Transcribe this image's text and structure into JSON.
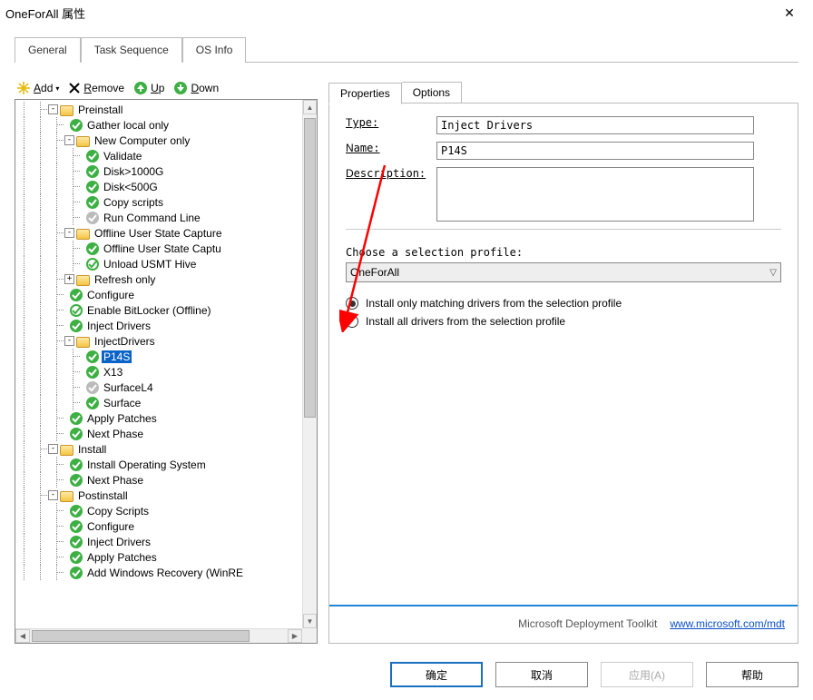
{
  "window": {
    "title": "OneForAll 属性"
  },
  "tabs": {
    "general": "General",
    "task_sequence": "Task Sequence",
    "os_info": "OS Info"
  },
  "toolbar": {
    "add": "Add",
    "remove": "Remove",
    "up": "Up",
    "down": "Down"
  },
  "subtabs": {
    "properties": "Properties",
    "options": "Options"
  },
  "form": {
    "type_label": "Type:",
    "name_label": "Name:",
    "desc_label": "Description:",
    "type_value": "Inject Drivers",
    "name_value": "P14S",
    "desc_value": ""
  },
  "profile": {
    "label": "Choose a selection profile:",
    "value": "OneForAll",
    "radio_match": "Install only matching drivers from the selection profile",
    "radio_all": "Install all drivers from the selection profile"
  },
  "footer": {
    "brand": "Microsoft Deployment Toolkit",
    "link_text": "www.microsoft.com/mdt"
  },
  "buttons": {
    "ok": "确定",
    "cancel": "取消",
    "apply": "应用(A)",
    "help": "帮助"
  },
  "tree": [
    {
      "d": 2,
      "t": "minus",
      "i": "folder",
      "lbl": "Preinstall"
    },
    {
      "d": 3,
      "t": "",
      "i": "green",
      "lbl": "Gather local only"
    },
    {
      "d": 3,
      "t": "minus",
      "i": "folder",
      "lbl": "New Computer only"
    },
    {
      "d": 4,
      "t": "",
      "i": "green",
      "lbl": "Validate"
    },
    {
      "d": 4,
      "t": "",
      "i": "green",
      "lbl": "Disk>1000G"
    },
    {
      "d": 4,
      "t": "",
      "i": "green",
      "lbl": "Disk<500G"
    },
    {
      "d": 4,
      "t": "",
      "i": "green",
      "lbl": "Copy scripts"
    },
    {
      "d": 4,
      "t": "",
      "i": "grey",
      "lbl": "Run Command Line"
    },
    {
      "d": 3,
      "t": "minus",
      "i": "folder",
      "lbl": "Offline User State Capture"
    },
    {
      "d": 4,
      "t": "",
      "i": "green",
      "lbl": "Offline User State Captu"
    },
    {
      "d": 4,
      "t": "",
      "i": "lgreen",
      "lbl": "Unload USMT Hive"
    },
    {
      "d": 3,
      "t": "plus",
      "i": "folder",
      "lbl": "Refresh only"
    },
    {
      "d": 3,
      "t": "",
      "i": "green",
      "lbl": "Configure"
    },
    {
      "d": 3,
      "t": "",
      "i": "lgreen",
      "lbl": "Enable BitLocker (Offline)"
    },
    {
      "d": 3,
      "t": "",
      "i": "green",
      "lbl": "Inject Drivers"
    },
    {
      "d": 3,
      "t": "minus",
      "i": "folder",
      "lbl": "InjectDrivers"
    },
    {
      "d": 4,
      "t": "",
      "i": "green",
      "lbl": "P14S",
      "sel": true
    },
    {
      "d": 4,
      "t": "",
      "i": "green",
      "lbl": "X13"
    },
    {
      "d": 4,
      "t": "",
      "i": "grey",
      "lbl": "SurfaceL4"
    },
    {
      "d": 4,
      "t": "",
      "i": "green",
      "lbl": "Surface"
    },
    {
      "d": 3,
      "t": "",
      "i": "green",
      "lbl": "Apply Patches"
    },
    {
      "d": 3,
      "t": "",
      "i": "green",
      "lbl": "Next Phase"
    },
    {
      "d": 2,
      "t": "minus",
      "i": "folder",
      "lbl": "Install"
    },
    {
      "d": 3,
      "t": "",
      "i": "green",
      "lbl": "Install Operating System"
    },
    {
      "d": 3,
      "t": "",
      "i": "green",
      "lbl": "Next Phase"
    },
    {
      "d": 2,
      "t": "minus",
      "i": "folder",
      "lbl": "Postinstall"
    },
    {
      "d": 3,
      "t": "",
      "i": "green",
      "lbl": "Copy Scripts"
    },
    {
      "d": 3,
      "t": "",
      "i": "green",
      "lbl": "Configure"
    },
    {
      "d": 3,
      "t": "",
      "i": "green",
      "lbl": "Inject Drivers"
    },
    {
      "d": 3,
      "t": "",
      "i": "green",
      "lbl": "Apply Patches"
    },
    {
      "d": 3,
      "t": "",
      "i": "green",
      "lbl": "Add Windows Recovery (WinRE"
    }
  ]
}
